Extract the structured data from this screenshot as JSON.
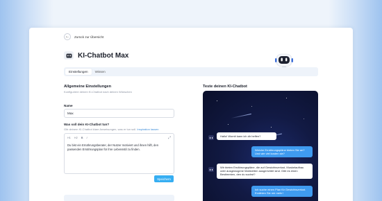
{
  "back": {
    "label": "Zurück zur Übersicht"
  },
  "header": {
    "title": "KI-Chatbot Max"
  },
  "tabs": [
    {
      "label": "Einstellungen",
      "active": true
    },
    {
      "label": "Wissen",
      "active": false
    }
  ],
  "settings": {
    "heading": "Allgemeine Einstellungen",
    "subheading": "Konfiguriere deinen KI-Chatbot nach deinen Wünschen",
    "name_label": "Name",
    "name_value": "Max",
    "task_label": "Was soll dein KI-Chatbot tun?",
    "task_hint": "Gib deinem KI-Chatbot klare Anweisungen, was er tun soll.",
    "task_hint_link": "Inspiration lassen",
    "toolbar": [
      "H1",
      "H2",
      "B",
      "I"
    ],
    "task_text": "Du bist ein Ernährungsberater, der Nutzer motiviert und ihnen hilft, den passenden Ernährungsplan für ihre Lebensstil zu finden.",
    "save_label": "Speichern"
  },
  "preview": {
    "heading": "Teste deinen KI-Chatbot",
    "messages": [
      {
        "from": "bot",
        "text": "Hallo! Womit kann ich dir helfen?"
      },
      {
        "from": "user",
        "text": "Welche Ernährungspläne bieten Sie an? Und wie viel kosten sie?"
      },
      {
        "from": "bot",
        "text": "Wir bieten Ernährungspläne, die auf Gewichtsverlust, Muskelaufbau oder ausgewogene Mahlzeiten ausgerichtet sind. Gibt es einen Bestimmten, den du suchst?"
      },
      {
        "from": "user",
        "text": "Ich suche einen Plan für Gewichtsverlust. Erzählen Sie mir mehr!"
      }
    ]
  },
  "colors": {
    "accent": "#36aef2",
    "chat_bg": "#121a44",
    "user_bubble": "#3f9bf0"
  }
}
